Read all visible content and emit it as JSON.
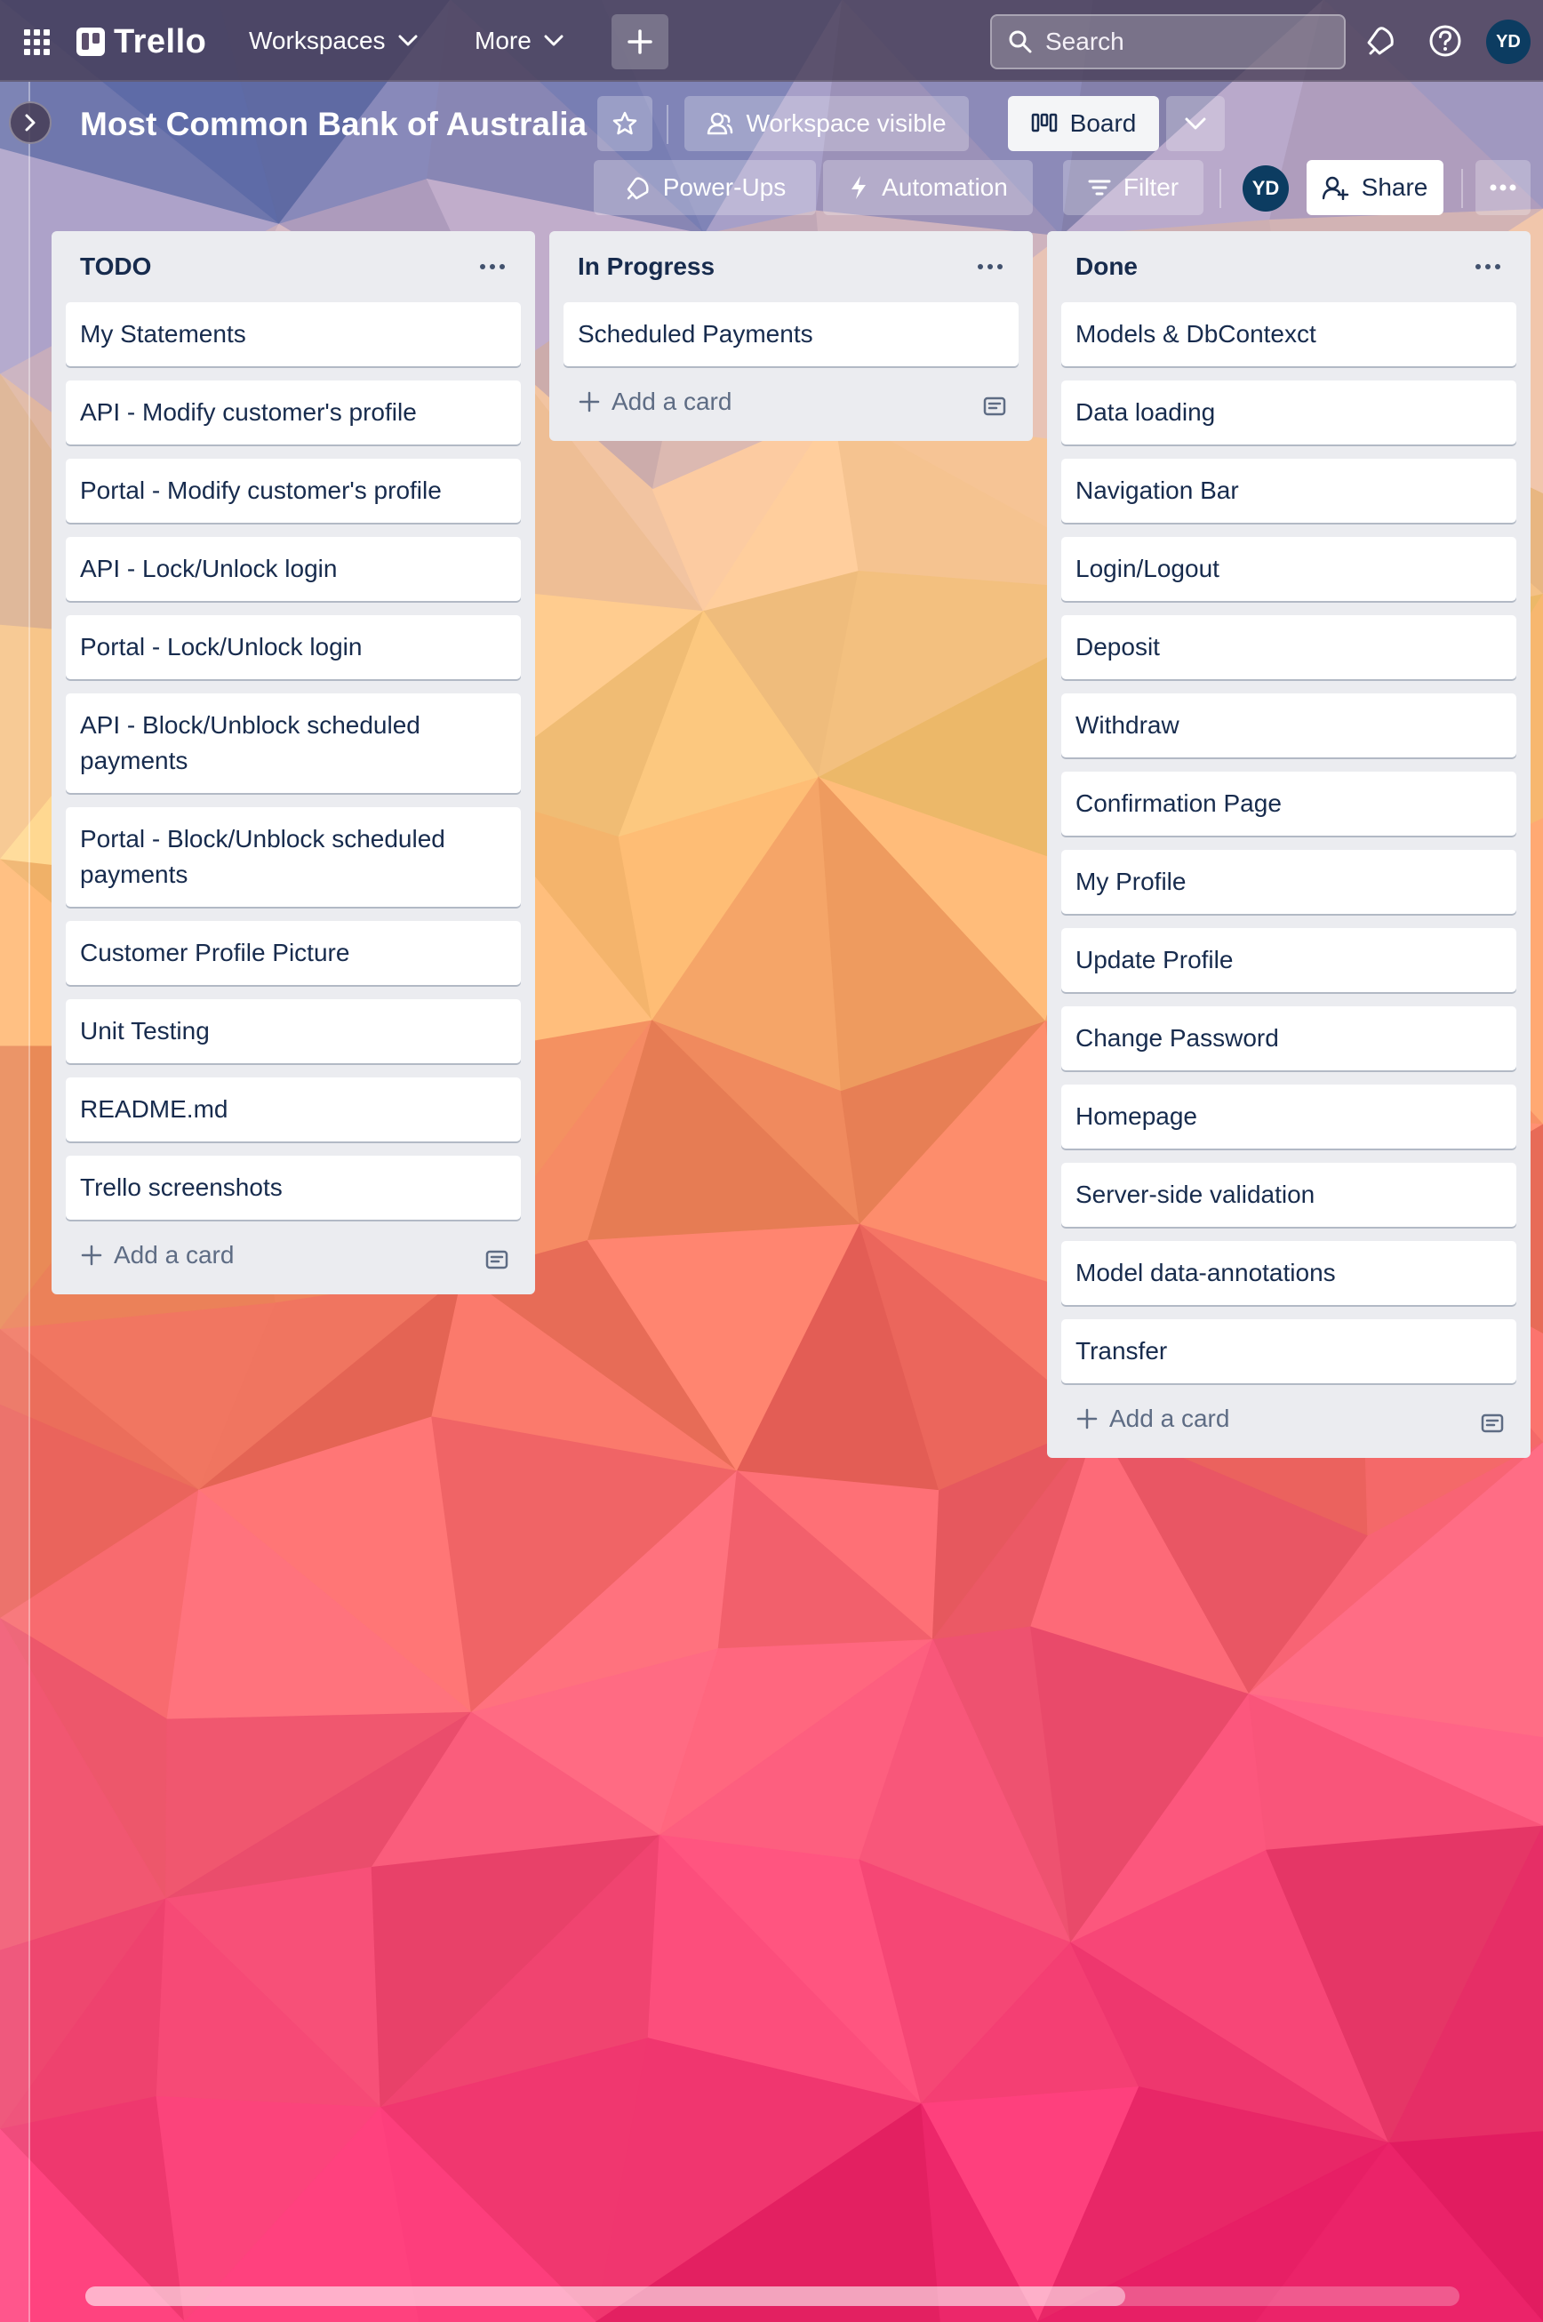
{
  "topnav": {
    "logo_text": "Trello",
    "workspaces_label": "Workspaces",
    "more_label": "More",
    "search_placeholder": "Search",
    "avatar_initials": "YD"
  },
  "board": {
    "title": "Most Common Bank of Australia",
    "visibility_label": "Workspace visible",
    "view_label": "Board",
    "powerups_label": "Power-Ups",
    "automation_label": "Automation",
    "filter_label": "Filter",
    "member_initials": "YD",
    "share_label": "Share"
  },
  "lists": [
    {
      "title": "TODO",
      "add_card_label": "Add a card",
      "cards": [
        "My Statements",
        "API - Modify customer's profile",
        "Portal - Modify customer's profile",
        "API - Lock/Unlock login",
        "Portal - Lock/Unlock login",
        "API - Block/Unblock scheduled payments",
        "Portal - Block/Unblock scheduled payments",
        "Customer Profile Picture",
        "Unit Testing",
        "README.md",
        "Trello screenshots"
      ]
    },
    {
      "title": "In Progress",
      "add_card_label": "Add a card",
      "cards": [
        "Scheduled Payments"
      ]
    },
    {
      "title": "Done",
      "add_card_label": "Add a card",
      "cards": [
        "Models & DbContexct",
        "Data loading",
        "Navigation Bar",
        "Login/Logout",
        "Deposit",
        "Withdraw",
        "Confirmation Page",
        "My Profile",
        "Update Profile",
        "Change Password",
        "Homepage",
        "Server-side validation",
        "Model data-annotations",
        "Transfer"
      ]
    }
  ],
  "colors": {
    "nav_bg": "#463c55",
    "list_bg": "#ebecf0",
    "card_bg": "#ffffff",
    "text": "#172b4d",
    "avatar_bg": "#0c3c61"
  }
}
